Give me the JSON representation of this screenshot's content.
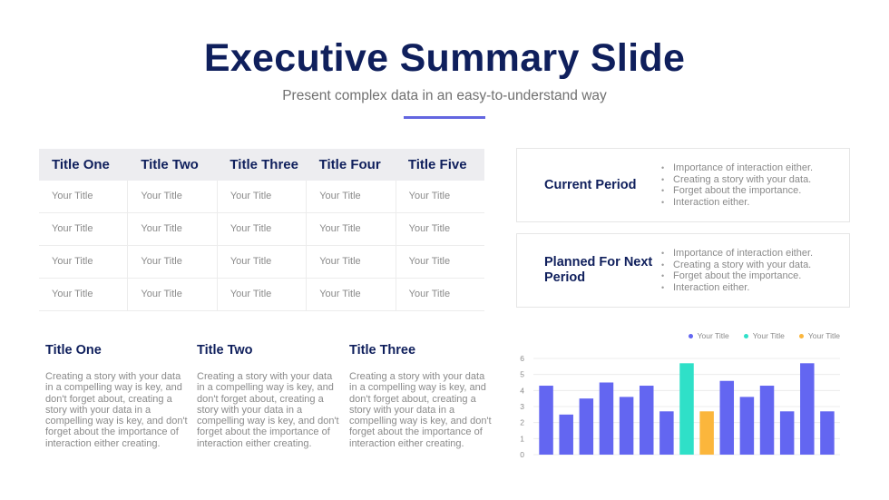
{
  "header": {
    "title": "Executive Summary Slide",
    "subtitle": "Present complex data in an easy-to-understand way",
    "accent_color": "#6366e0",
    "title_color": "#0f1f5c"
  },
  "table": {
    "columns": [
      "Title One",
      "Title Two",
      "Title Three",
      "Title Four",
      "Title Five"
    ],
    "rows": [
      [
        "Your Title",
        "Your Title",
        "Your Title",
        "Your Title",
        "Your Title"
      ],
      [
        "Your Title",
        "Your Title",
        "Your Title",
        "Your Title",
        "Your Title"
      ],
      [
        "Your Title",
        "Your Title",
        "Your Title",
        "Your Title",
        "Your Title"
      ],
      [
        "Your Title",
        "Your Title",
        "Your Title",
        "Your Title",
        "Your Title"
      ]
    ]
  },
  "cards": [
    {
      "title": "Current Period",
      "bullets": [
        "Importance of interaction either.",
        "Creating a story with your data.",
        "Forget about the importance.",
        "Interaction either."
      ]
    },
    {
      "title": "Planned For Next Period",
      "bullets": [
        "Importance of interaction either.",
        "Creating a story with your data.",
        "Forget about the importance.",
        "Interaction either."
      ]
    }
  ],
  "columns": [
    {
      "title": "Title One",
      "body": "Creating a story with your data in a compelling way is key, and don't forget about, creating a story with your data in a compelling way is key, and don't forget about the importance of interaction either creating."
    },
    {
      "title": "Title Two",
      "body": "Creating a story with your data in a compelling way is key, and don't forget about, creating a story with your data in a compelling way is key, and don't forget about the importance of interaction either creating."
    },
    {
      "title": "Title Three",
      "body": "Creating a story with your data in a compelling way is key, and don't forget about, creating a story with your data in a compelling way is key, and don't forget about the importance of interaction either creating."
    }
  ],
  "chart_data": {
    "type": "bar",
    "title": "",
    "xlabel": "",
    "ylabel": "",
    "ylim": [
      0,
      6
    ],
    "yticks": [
      0,
      1,
      2,
      3,
      4,
      5,
      6
    ],
    "grid": true,
    "legend_position": "top-right",
    "legend": [
      {
        "name": "Your Title",
        "color": "#6366f1"
      },
      {
        "name": "Your Title",
        "color": "#2fe0c8"
      },
      {
        "name": "Your Title",
        "color": "#fbb63c"
      }
    ],
    "values": [
      4.3,
      2.5,
      3.5,
      4.5,
      3.6,
      4.3,
      2.7,
      5.7,
      2.7,
      4.6,
      3.6,
      4.3,
      2.7,
      5.7,
      2.7
    ],
    "series_index": [
      0,
      0,
      0,
      0,
      0,
      0,
      0,
      1,
      2,
      0,
      0,
      0,
      0,
      0,
      0
    ]
  }
}
